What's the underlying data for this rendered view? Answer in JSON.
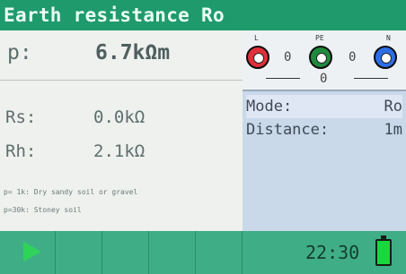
{
  "title": "Earth resistance Ro",
  "main": {
    "rho_label": "p:",
    "rho_value": "6.7kΩm",
    "rs_label": "Rs:",
    "rs_value": "0.0kΩ",
    "rh_label": "Rh:",
    "rh_value": "2.1kΩ",
    "note1": "p= 1k: Dry sandy soil or gravel",
    "note2": "p=30k: Stoney soil"
  },
  "terminals": {
    "l_tag": "L",
    "pe_tag": "PE",
    "n_tag": "N",
    "v_l_pe": "0",
    "v_pe_n": "0",
    "v_l_n": "0",
    "colors": {
      "l": "#e0303a",
      "pe": "#1f8a3e",
      "n": "#2d6ee8"
    }
  },
  "params": {
    "mode_label": "Mode:",
    "mode_value": "Ro",
    "distance_label": "Distance:",
    "distance_value": "1m"
  },
  "status": {
    "time": "22:30",
    "play_icon": "play-icon",
    "battery_icon": "battery-icon"
  },
  "colors": {
    "title_bar": "#1f9a6c",
    "status_bar": "#3fae86",
    "right_panel": "#c9d9ea"
  }
}
